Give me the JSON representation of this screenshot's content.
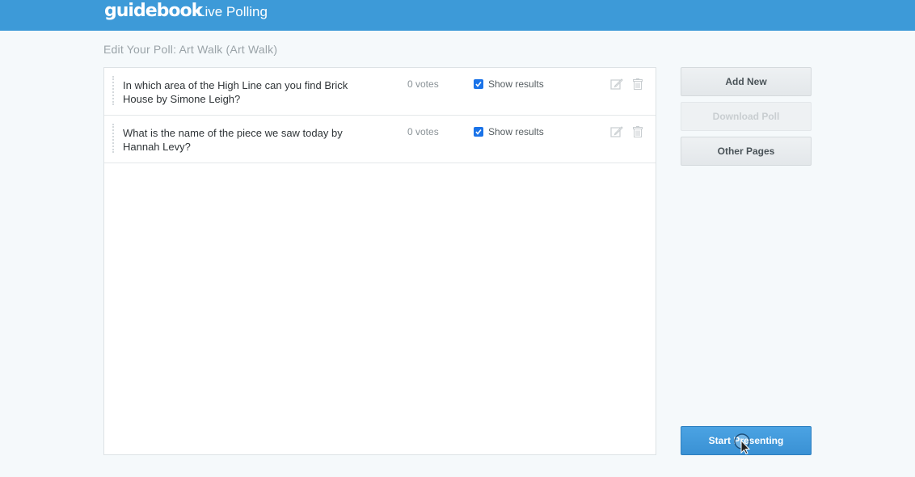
{
  "header": {
    "logo": "guidebook",
    "app_title": "Live Polling"
  },
  "page_title": "Edit Your Poll: Art Walk (Art Walk)",
  "polls": [
    {
      "question": "In which area of the High Line can you find Brick House by Simone Leigh?",
      "votes": "0 votes",
      "show_results_label": "Show results",
      "show_results_checked": true
    },
    {
      "question": "What is the name of the piece we saw today by Hannah Levy?",
      "votes": "0 votes",
      "show_results_label": "Show results",
      "show_results_checked": true
    }
  ],
  "sidebar": {
    "add_new": "Add New",
    "download_poll": "Download Poll",
    "other_pages": "Other Pages",
    "start_presenting": "Start Presenting"
  },
  "colors": {
    "header_bg": "#3d9ad8",
    "primary_button": "#3a91d4",
    "checkbox": "#1a73e8"
  }
}
